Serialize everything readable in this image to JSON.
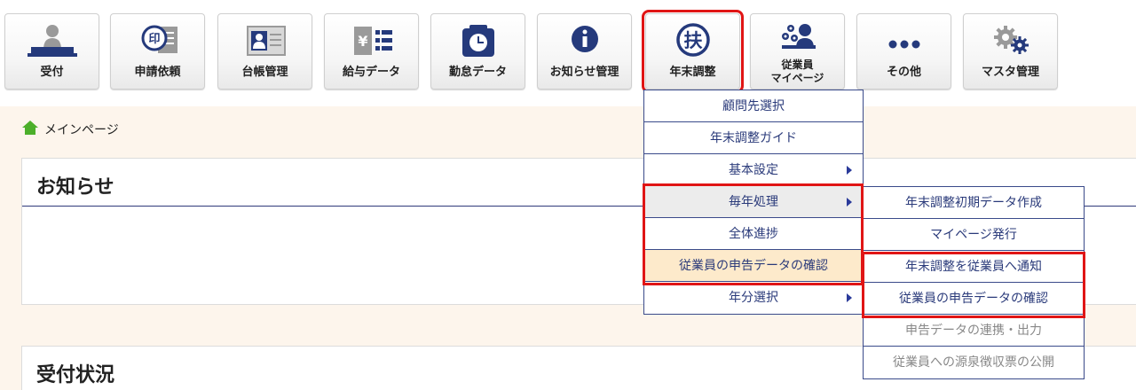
{
  "toolbar": {
    "buttons": [
      {
        "label": "受付",
        "icon": "reception-person-icon"
      },
      {
        "label": "申請依頼",
        "icon": "stamp-document-icon"
      },
      {
        "label": "台帳管理",
        "icon": "id-card-icon"
      },
      {
        "label": "給与データ",
        "icon": "yen-list-icon"
      },
      {
        "label": "勤怠データ",
        "icon": "timecard-clock-icon"
      },
      {
        "label": "お知らせ管理",
        "icon": "info-icon"
      },
      {
        "label": "年末調整",
        "icon": "fu-kanji-circle-icon"
      },
      {
        "label_line1": "従業員",
        "label_line2": "マイページ",
        "icon": "employee-mypage-icon"
      },
      {
        "label": "その他",
        "icon": "more-dots-icon"
      },
      {
        "label": "マスタ管理",
        "icon": "gears-icon"
      }
    ],
    "fu_kanji": "扶",
    "stamp_kanji": "印",
    "yen": "¥"
  },
  "breadcrumb": {
    "label": "メインページ"
  },
  "panels": [
    {
      "title": "お知らせ"
    },
    {
      "title": "受付状況"
    }
  ],
  "menu_main": {
    "items": [
      {
        "label": "顧問先選択"
      },
      {
        "label": "年末調整ガイド"
      },
      {
        "label": "基本設定"
      },
      {
        "label": "毎年処理"
      },
      {
        "label": "全体進捗"
      },
      {
        "label": "従業員の申告データの確認"
      },
      {
        "label": "年分選択"
      }
    ]
  },
  "menu_sub": {
    "items": [
      {
        "label": "年末調整初期データ作成"
      },
      {
        "label": "マイページ発行"
      },
      {
        "label": "年末調整を従業員へ通知"
      },
      {
        "label": "従業員の申告データの確認"
      },
      {
        "label": "申告データの連携・出力"
      },
      {
        "label": "従業員への源泉徴収票の公開"
      }
    ]
  },
  "colors": {
    "highlight": "#e01515",
    "menu_border": "#3a4a8a",
    "content_bg": "#fdf5ec",
    "selected_bg": "#fdeacb"
  }
}
